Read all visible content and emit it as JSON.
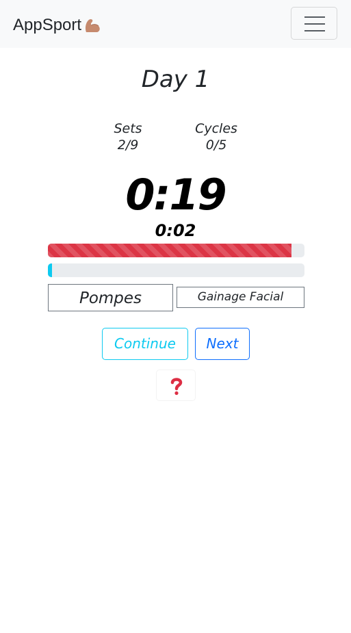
{
  "navbar": {
    "brand": "AppSport",
    "brand_icon": "flexed-biceps-icon",
    "toggler_icon": "hamburger-menu-icon"
  },
  "workout": {
    "title": "Day 1",
    "sets_label": "Sets",
    "sets_value": "2/9",
    "cycles_label": "Cycles",
    "cycles_value": "0/5",
    "timer": "0:19",
    "subtimer": "0:02",
    "progress_main": 0.95,
    "progress_secondary": 0.015,
    "current_exercise": "Pompes",
    "next_exercise": "Gainage Facial"
  },
  "actions": {
    "continue_label": "Continue",
    "next_label": "Next",
    "help_icon": "question-mark-icon"
  },
  "colors": {
    "danger": "#dc3545",
    "info": "#0dcaf0",
    "primary": "#0d6efd",
    "navbar_bg": "#f8f9fa"
  }
}
